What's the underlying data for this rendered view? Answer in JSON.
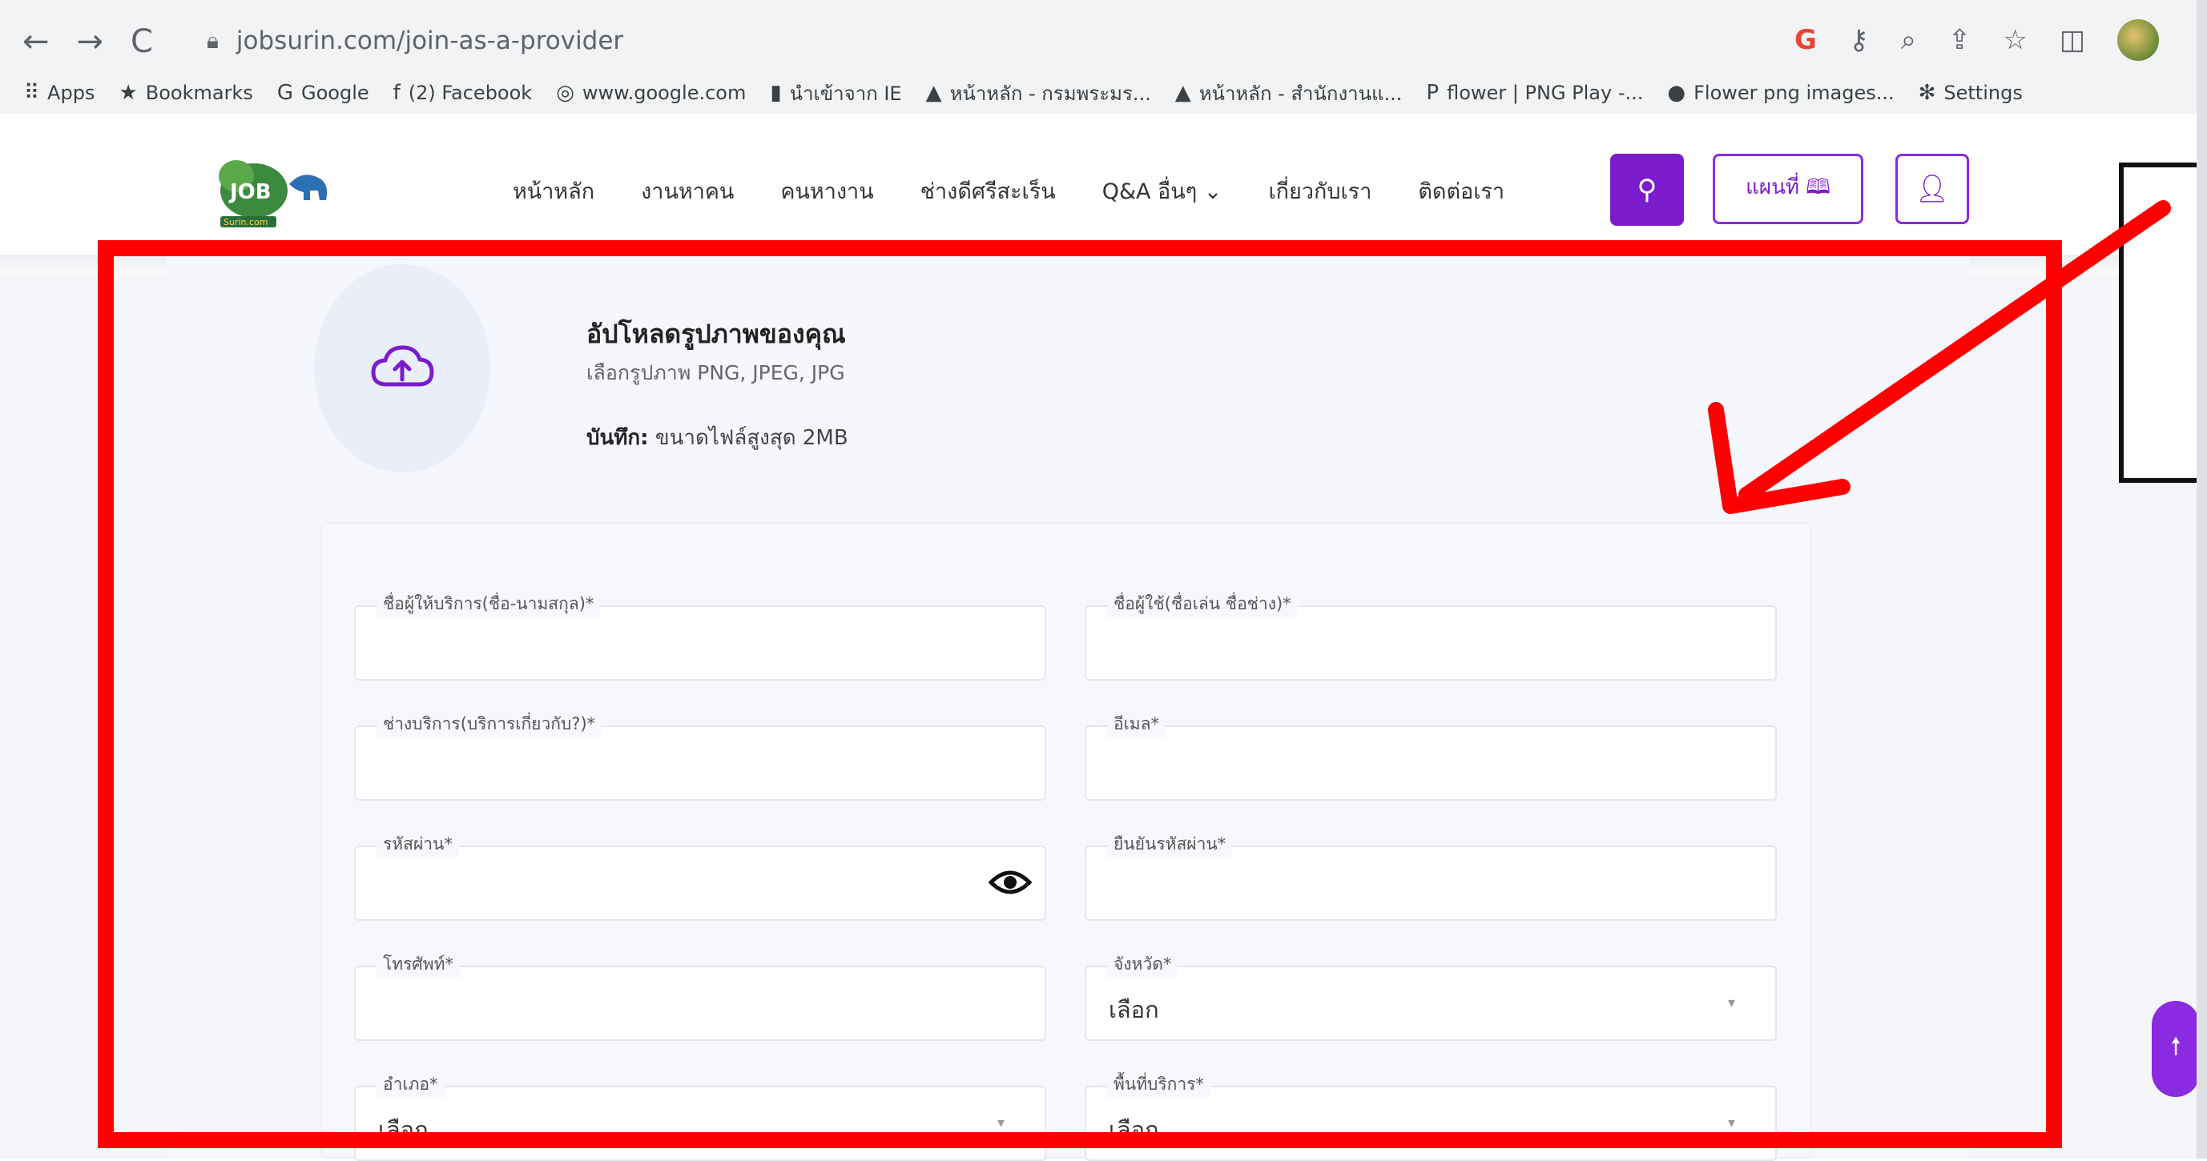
{
  "browser": {
    "url": "jobsurin.com/join-as-a-provider",
    "nav": {
      "back": "←",
      "forward": "→",
      "reload": "C"
    },
    "bookmarks": [
      {
        "icon": "apps-grid-icon",
        "glyph": "⠿",
        "label": "Apps"
      },
      {
        "icon": "star-icon",
        "glyph": "★",
        "label": "Bookmarks"
      },
      {
        "icon": "google-icon",
        "glyph": "G",
        "label": "Google"
      },
      {
        "icon": "facebook-icon",
        "glyph": "f",
        "label": "(2) Facebook"
      },
      {
        "icon": "globe-icon",
        "glyph": "◎",
        "label": "www.google.com"
      },
      {
        "icon": "folder-icon",
        "glyph": "▮",
        "label": "นำเข้าจาก IE"
      },
      {
        "icon": "site-icon",
        "glyph": "▲",
        "label": "หน้าหลัก - กรมพระมร..."
      },
      {
        "icon": "site-icon",
        "glyph": "▲",
        "label": "หน้าหลัก - สำนักงานแ..."
      },
      {
        "icon": "pinterest-icon",
        "glyph": "P",
        "label": "flower | PNG Play -..."
      },
      {
        "icon": "flower-icon",
        "glyph": "●",
        "label": "Flower png images..."
      },
      {
        "icon": "gear-icon",
        "glyph": "✻",
        "label": "Settings"
      }
    ]
  },
  "site": {
    "nav": [
      "หน้าหลัก",
      "งานหาคน",
      "คนหางาน",
      "ช่างดีศรีสะเร็น",
      "Q&A อื่นๆ ⌄",
      "เกี่ยวกับเรา",
      "ติดต่อเรา"
    ],
    "map_label": "แผนที่ 🕮",
    "accent": "#7b1ccc"
  },
  "upload": {
    "title": "อัปโหลดรูปภาพของคุณ",
    "subtitle": "เลือกรูปภาพ PNG, JPEG, JPG",
    "note_label": "บันทึก:",
    "note_text": " ขนาดไฟล์สูงสุด 2MB"
  },
  "form": {
    "provider_name": "ชื่อผู้ให้บริการ(ชื่อ-นามสกุล)*",
    "username": "ชื่อผู้ใช้(ชื่อเล่น ชื่อช่าง)*",
    "service_type": "ช่างบริการ(บริการเกี่ยวกับ?)*",
    "email": "อีเมล*",
    "password": "รหัสผ่าน*",
    "confirm_password": "ยืนยันรหัสผ่าน*",
    "phone": "โทรศัพท์*",
    "province": "จังหวัด*",
    "province_value": "เลือก",
    "district": "อำเภอ*",
    "district_value": "เลือก",
    "service_area": "พื้นที่บริการ*",
    "service_area_value": "เลือก"
  },
  "colors": {
    "annotation_red": "#ff0000",
    "purple": "#8a2be2"
  }
}
